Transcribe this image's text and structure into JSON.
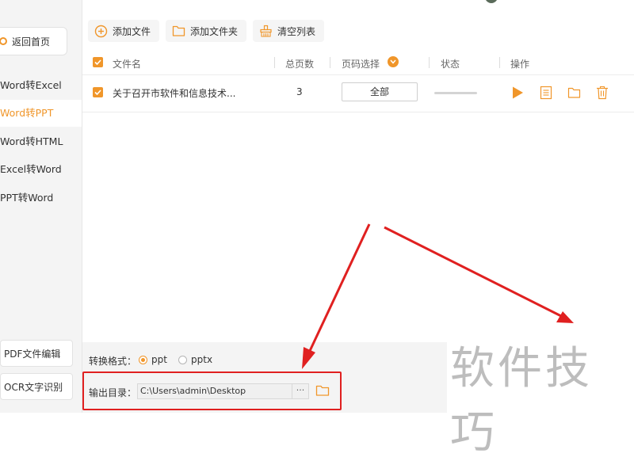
{
  "sidebar": {
    "back_label": "返回首页",
    "items": [
      {
        "label": "Word转Excel",
        "active": false
      },
      {
        "label": "Word转PPT",
        "active": true
      },
      {
        "label": "Word转HTML",
        "active": false
      },
      {
        "label": "Excel转Word",
        "active": false
      },
      {
        "label": "PPT转Word",
        "active": false
      }
    ],
    "tools": [
      "PDF文件编辑",
      "OCR文字识别"
    ]
  },
  "toolbar": {
    "add_file": "添加文件",
    "add_folder": "添加文件夹",
    "clear_list": "清空列表"
  },
  "table": {
    "headers": {
      "filename": "文件名",
      "total_pages": "总页数",
      "page_select": "页码选择",
      "status": "状态",
      "actions": "操作"
    },
    "rows": [
      {
        "filename": "关于召开市软件和信息技术...",
        "pages": "3",
        "page_select": "全部"
      }
    ]
  },
  "output": {
    "format_label": "转换格式：",
    "formats": [
      "ppt",
      "pptx"
    ],
    "selected_format": "ppt",
    "dir_label": "输出目录：",
    "dir_value": "C:\\Users\\admin\\Desktop",
    "more_label": "···"
  },
  "watermark": "软件技巧",
  "colors": {
    "accent": "#f0962a",
    "annotation": "#e02020",
    "sidebar_bg": "#f4f4f4"
  }
}
